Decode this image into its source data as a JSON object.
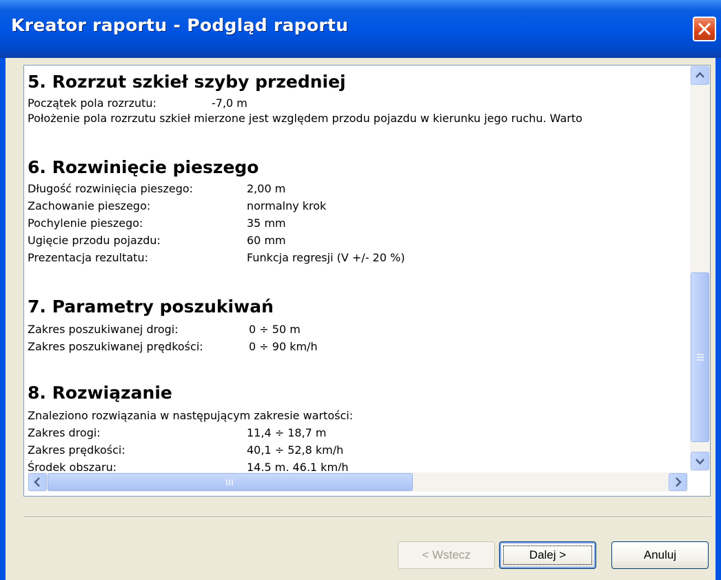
{
  "window": {
    "title": "Kreator raportu - Podgląd raportu"
  },
  "report": {
    "sections": [
      {
        "title": "5. Rozrzut szkieł szyby przedniej",
        "rows": [
          {
            "label": "Początek pola rozrzutu:",
            "value": "-7,0 m"
          }
        ],
        "note": "Położenie pola rozrzutu szkieł mierzone jest względem przodu pojazdu w kierunku jego ruchu. Warto"
      },
      {
        "title": "6. Rozwinięcie pieszego",
        "rows": [
          {
            "label": "Długość rozwinięcia pieszego:",
            "value": "2,00 m"
          },
          {
            "label": "Zachowanie pieszego:",
            "value": "normalny krok"
          },
          {
            "label": "Pochylenie pieszego:",
            "value": "35 mm"
          },
          {
            "label": "Ugięcie przodu pojazdu:",
            "value": "60 mm"
          },
          {
            "label": "Prezentacja rezultatu:",
            "value": "Funkcja regresji (V +/- 20 %)"
          }
        ]
      },
      {
        "title": "7. Parametry poszukiwań",
        "rows": [
          {
            "label": "Zakres poszukiwanej drogi:",
            "value": "0 ÷ 50 m"
          },
          {
            "label": "Zakres poszukiwanej prędkości:",
            "value": "0 ÷ 90 km/h"
          }
        ]
      },
      {
        "title": "8. Rozwiązanie",
        "intro": "Znaleziono rozwiązania w następującym zakresie wartości:",
        "rows": [
          {
            "label": "Zakres drogi:",
            "value": "11,4 ÷ 18,7 m"
          },
          {
            "label": "Zakres prędkości:",
            "value": "40,1 ÷ 52,8 km/h"
          },
          {
            "label": "Środek obszaru:",
            "value": "14,5 m, 46,1 km/h"
          }
        ]
      }
    ]
  },
  "buttons": {
    "back": "< Wstecz",
    "next": "Dalej >",
    "cancel": "Anuluj"
  },
  "icons": {
    "close": "close-icon",
    "scroll_up": "arrow-up-icon",
    "scroll_down": "arrow-down-icon",
    "scroll_left": "arrow-left-icon",
    "scroll_right": "arrow-right-icon"
  },
  "colors": {
    "titlebar": "#0054e3",
    "close": "#d9471b",
    "scrollbar": "#b7cdf9"
  }
}
